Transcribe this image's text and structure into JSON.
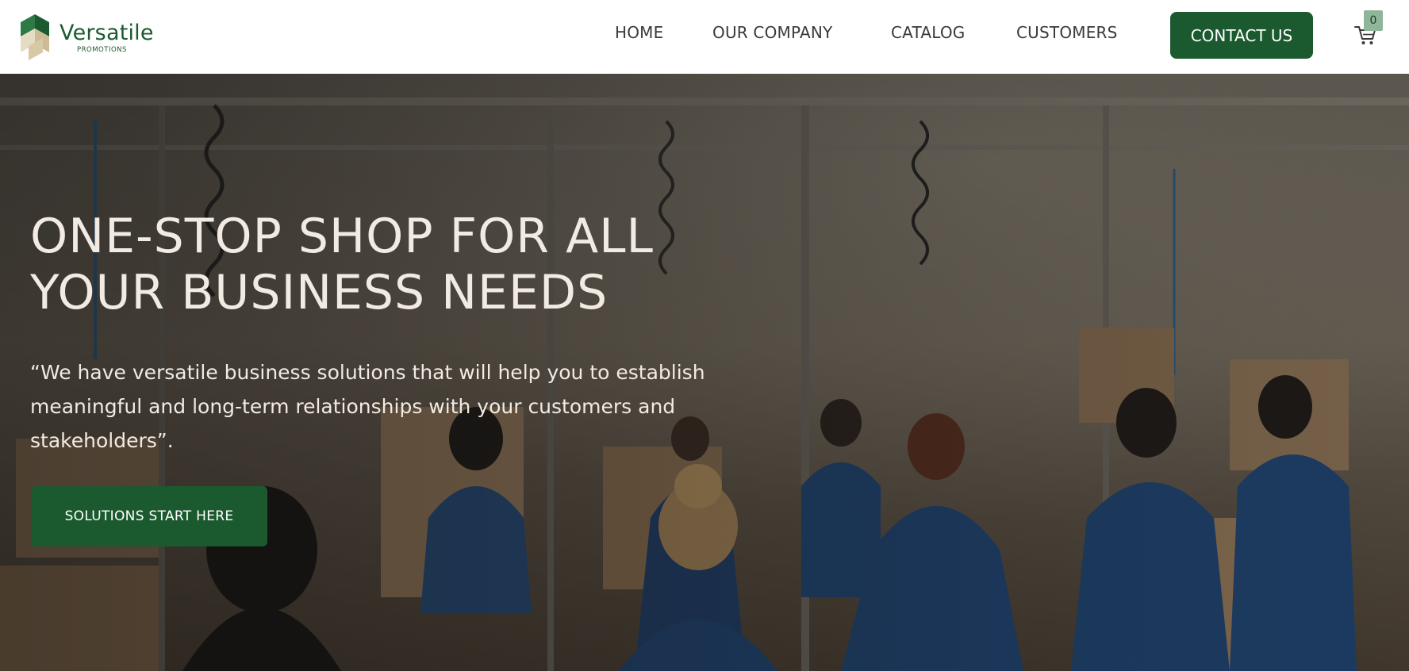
{
  "brand": {
    "name": "Versatile",
    "tagline": "PROMOTIONS",
    "colors": {
      "primary_green": "#1b5a2f",
      "logo_tan": "#cdbb95",
      "badge_green": "#8fb69b",
      "hero_text": "#f2ebe4"
    }
  },
  "nav": {
    "items": [
      {
        "label": "HOME"
      },
      {
        "label": "OUR COMPANY"
      },
      {
        "label": "CATALOG"
      },
      {
        "label": "CUSTOMERS"
      }
    ],
    "contact_label": "CONTACT US",
    "cart": {
      "icon": "cart-icon",
      "count": "0"
    }
  },
  "hero": {
    "title_line1": "ONE-STOP SHOP FOR ALL",
    "title_line2": "YOUR BUSINESS NEEDS",
    "quote": "“We have versatile business solutions that will help you to establish meaningful and long-term relationships with your customers and stakeholders”.",
    "cta_label": "SOLUTIONS START HERE",
    "background": "factory-workers-photo"
  }
}
